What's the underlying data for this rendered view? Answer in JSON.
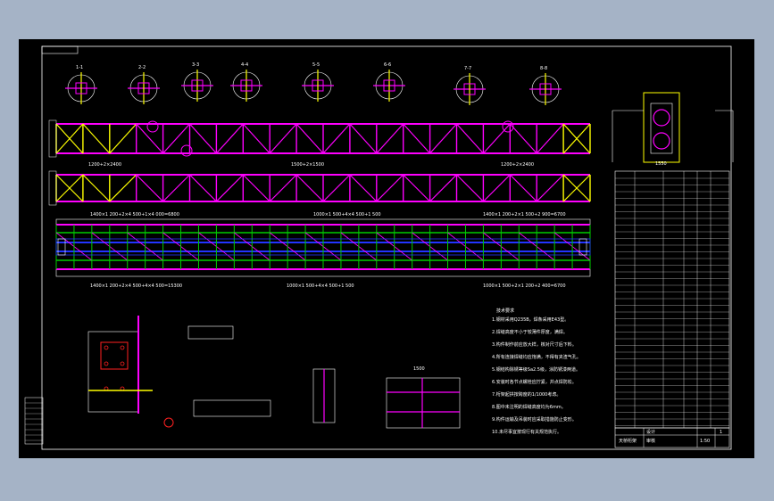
{
  "colors": {
    "background": "#a5b3c6",
    "canvas": "#000000",
    "frame": "#ffffff",
    "truss": "#ff00ff",
    "joint": "#ffff00",
    "green": "#00cc00",
    "blue": "#2233ff",
    "red": "#ff2020",
    "cyan": "#00ffff"
  },
  "dimensions": {
    "top_left": "1200+2×2400",
    "top_mid": "1500+2×1500",
    "top_right": "1200+2×2400",
    "plan_top_left": "1400×1 200+2×4 500+1×4 000=6800",
    "plan_top_mid": "1000×1 500+4×4 500+1 500",
    "plan_top_right": "1400×1 200+2×1 500+2 900=6700",
    "plan_bot_left": "1400×1 200+2×4 500+4×4 500=15300",
    "plan_bot_mid": "1000×1 500+4×4 500+1 500",
    "plan_bot_right": "1000×1 500+2×1 200+2 400=6700",
    "side_width": "1550",
    "plan_view_cap": "1500",
    "detail_width": "1500"
  },
  "section_marks": [
    "1-1",
    "2-2",
    "3-3",
    "4-4",
    "5-5",
    "6-6",
    "7-7",
    "8-8"
  ],
  "notes": {
    "title": "技术要求",
    "lines": [
      "1.钢材采用Q235B，焊条采用E43型。",
      "2.焊缝高度不小于较薄件厚度，满焊。",
      "3.构件制作前应放大样，核对尺寸后下料。",
      "4.所有连接焊缝均应饱满，不得有夹渣气孔。",
      "5.钢结构除锈等级Sa2.5级，涂防锈漆两道。",
      "6.安装时各节点螺栓应拧紧，并点焊防松。",
      "7.桁架起拱按跨度的1/1000考虑。",
      "8.图中未注明的焊缝高度均为6mm。",
      "9.构件运输及吊装时应采取措施防止变形。",
      "10.未尽事宜按现行有关规范执行。"
    ]
  },
  "title_block": {
    "drawing_name": "天桥桁架",
    "sheet": "1",
    "scale": "1:50",
    "design": "设计",
    "check": "审核"
  }
}
